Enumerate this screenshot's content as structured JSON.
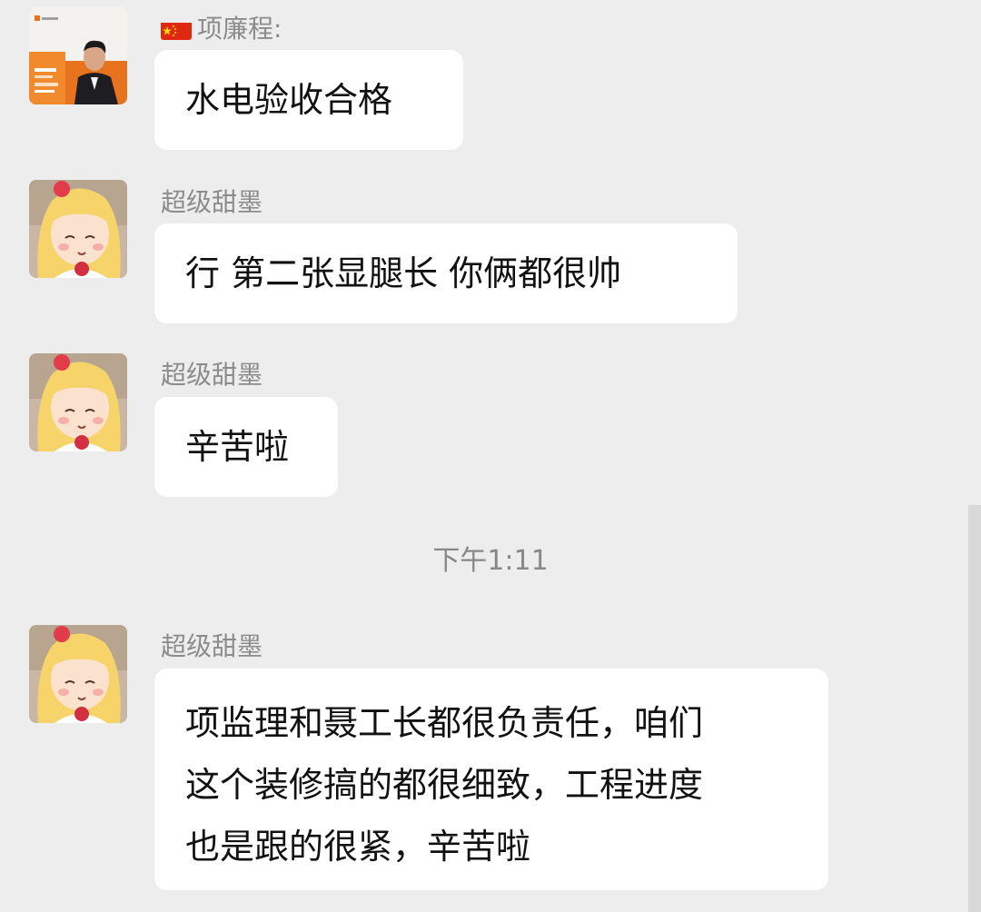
{
  "messages": [
    {
      "sender": "项廉程:",
      "lines": [
        "水电验收合格"
      ]
    },
    {
      "sender": "超级甜墨",
      "lines": [
        "行 第二张显腿长 你俩都很帅"
      ]
    },
    {
      "sender": "超级甜墨",
      "lines": [
        "辛苦啦"
      ]
    },
    {
      "sender": "超级甜墨",
      "lines": [
        "项监理和聂工长都很负责任，咱们",
        "这个装修搞的都很细致，工程进度",
        "也是跟的很紧，辛苦啦"
      ]
    }
  ],
  "timestamp": "下午1:11",
  "colors": {
    "background": "#ededed",
    "bubble": "#ffffff",
    "sender_text": "#8c8c8c",
    "timestamp_text": "#888888"
  }
}
